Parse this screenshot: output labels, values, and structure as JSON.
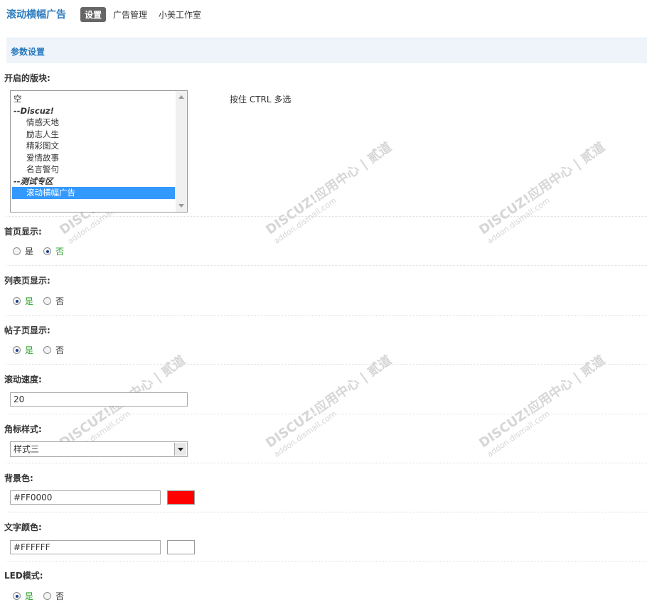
{
  "header": {
    "app_title": "滚动横幅广告",
    "tabs": [
      {
        "label": "设置",
        "active": true
      },
      {
        "label": "广告管理",
        "active": false
      },
      {
        "label": "小美工作室",
        "active": false
      }
    ]
  },
  "section": {
    "title": "参数设置"
  },
  "blocks": {
    "label": "开启的版块:",
    "hint": "按住 CTRL 多选",
    "options": [
      {
        "text": "空",
        "type": "item"
      },
      {
        "text": "--Discuz!",
        "type": "group"
      },
      {
        "text": "情感天地",
        "type": "child"
      },
      {
        "text": "励志人生",
        "type": "child"
      },
      {
        "text": "精彩图文",
        "type": "child"
      },
      {
        "text": "爱情故事",
        "type": "child"
      },
      {
        "text": "名言警句",
        "type": "child"
      },
      {
        "text": "--测试专区",
        "type": "group"
      },
      {
        "text": "滚动横幅广告",
        "type": "child",
        "selected": true
      }
    ]
  },
  "home_display": {
    "label": "首页显示:",
    "yes": "是",
    "no": "否",
    "value": "no"
  },
  "list_display": {
    "label": "列表页显示:",
    "yes": "是",
    "no": "否",
    "value": "yes"
  },
  "thread_display": {
    "label": "帖子页显示:",
    "yes": "是",
    "no": "否",
    "value": "yes"
  },
  "scroll_speed": {
    "label": "滚动速度:",
    "value": "20"
  },
  "corner_style": {
    "label": "角标样式:",
    "value": "样式三"
  },
  "bg_color": {
    "label": "背景色:",
    "value": "#FF0000",
    "swatch": "#FF0000"
  },
  "text_color": {
    "label": "文字颜色:",
    "value": "#FFFFFF",
    "swatch": "#FFFFFF"
  },
  "led_mode": {
    "label": "LED模式:",
    "yes": "是",
    "no": "否",
    "value": "yes"
  },
  "watermark": {
    "line1": "DISCUZ!应用中心 | 贰道",
    "line2": "addon.dismall.com"
  },
  "colors": {
    "accent": "#2b7bbf",
    "section_bg": "#eef4fa",
    "selected": "#3399ff",
    "yes_green": "#2aa02a"
  }
}
